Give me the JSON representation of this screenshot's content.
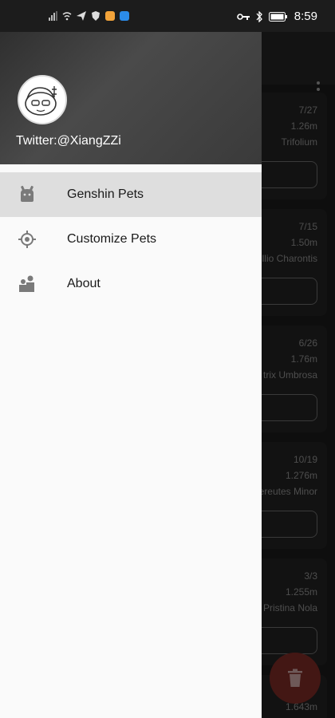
{
  "status_bar": {
    "time": "8:59",
    "icons_left": [
      "signal-icon",
      "wifi-icon",
      "send-icon",
      "shield-icon",
      "app-badge-icon",
      "app-badge-blue-icon"
    ],
    "icons_right": [
      "key-icon",
      "bluetooth-icon",
      "battery-icon"
    ]
  },
  "drawer": {
    "header": {
      "handle": "Twitter:@XiangZZi"
    },
    "items": [
      {
        "label": "Genshin Pets",
        "icon": "android-icon",
        "selected": true
      },
      {
        "label": "Customize Pets",
        "icon": "crosshair-icon",
        "selected": false
      },
      {
        "label": "About",
        "icon": "people-icon",
        "selected": false
      }
    ]
  },
  "background": {
    "cards": [
      {
        "date": "7/27",
        "size": "1.26m",
        "name": "Trifolium"
      },
      {
        "date": "7/15",
        "size": "1.50m",
        "name": "llio Charontis"
      },
      {
        "date": "6/26",
        "size": "1.76m",
        "name": "trix Umbrosa"
      },
      {
        "date": "10/19",
        "size": "1.276m",
        "name": "ereutes Minor"
      },
      {
        "date": "3/3",
        "size": "1.255m",
        "name": "Pristina Nola"
      },
      {
        "date": "",
        "size": "1.643m",
        "name": ""
      }
    ],
    "fab": {
      "icon": "delete-icon"
    }
  },
  "colors": {
    "accent": "#7a2a26",
    "drawer_bg": "#fafafa",
    "selected_bg": "#dedede"
  }
}
